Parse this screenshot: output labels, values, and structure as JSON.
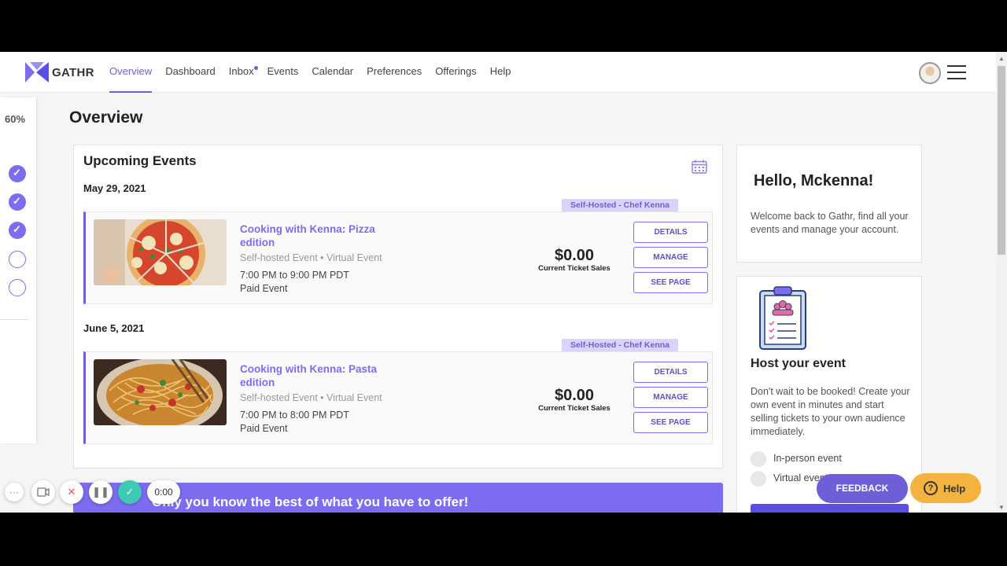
{
  "app": {
    "name": "GATHR",
    "accent_color": "#6e5fd8"
  },
  "nav": {
    "links": [
      "Overview",
      "Dashboard",
      "Inbox",
      "Events",
      "Calendar",
      "Preferences",
      "Offerings",
      "Help"
    ],
    "active": "Overview"
  },
  "progress": {
    "percent_label": "60%",
    "steps_done": 3,
    "steps_total": 5
  },
  "page": {
    "title": "Overview"
  },
  "upcoming": {
    "title": "Upcoming Events",
    "events": [
      {
        "date": "May 29, 2021",
        "badge": "Self-Hosted - Chef Kenna",
        "name": "Cooking with Kenna: Pizza edition",
        "type": "Self-hosted Event • Virtual Event",
        "time": "7:00 PM to 9:00 PM PDT",
        "paid": "Paid Event",
        "price": "$0.00",
        "price_label": "Current Ticket Sales",
        "buttons": [
          "DETAILS",
          "MANAGE",
          "SEE PAGE"
        ]
      },
      {
        "date": "June 5, 2021",
        "badge": "Self-Hosted - Chef Kenna",
        "name": "Cooking with Kenna: Pasta edition",
        "type": "Self-hosted Event • Virtual Event",
        "time": "7:00 PM to 8:00 PM PDT",
        "paid": "Paid Event",
        "price": "$0.00",
        "price_label": "Current Ticket Sales",
        "buttons": [
          "DETAILS",
          "MANAGE",
          "SEE PAGE"
        ]
      }
    ]
  },
  "banner": {
    "text": "Only you know the best of what you have to offer!"
  },
  "hello": {
    "title": "Hello, Mckenna!",
    "text": "Welcome back to Gathr, find all your events and manage your account."
  },
  "host": {
    "title": "Host your event",
    "text": "Don't wait to be booked! Create your own event in minutes and start selling tickets to your own audience immediately.",
    "options": [
      "In-person event",
      "Virtual event"
    ]
  },
  "floating": {
    "feedback": "FEEDBACK",
    "help": "Help"
  },
  "recorder": {
    "time": "0:00"
  }
}
